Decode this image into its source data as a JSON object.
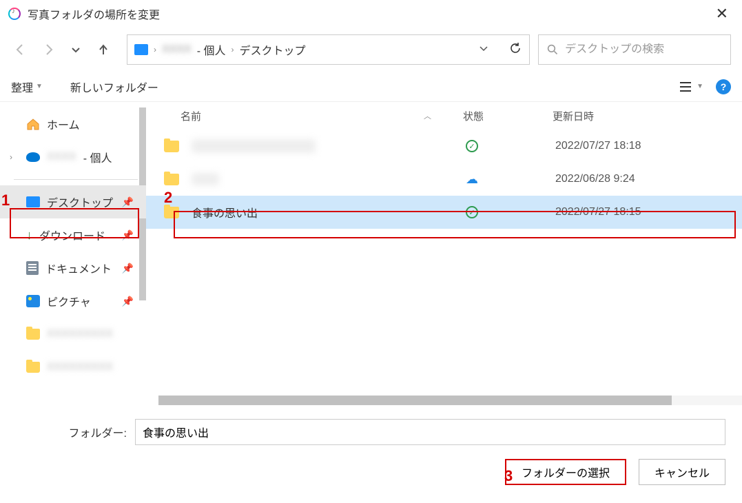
{
  "window": {
    "title": "写真フォルダの場所を変更"
  },
  "address": {
    "user_suffix": "- 個人",
    "crumb2": "デスクトップ"
  },
  "search": {
    "placeholder": "デスクトップの検索"
  },
  "toolbar": {
    "organize": "整理",
    "new_folder": "新しいフォルダー"
  },
  "sidebar": {
    "home": "ホーム",
    "personal_suffix": "- 個人",
    "desktop": "デスクトップ",
    "downloads": "ダウンロード",
    "documents": "ドキュメント",
    "pictures": "ピクチャ"
  },
  "columns": {
    "name": "名前",
    "status": "状態",
    "modified": "更新日時"
  },
  "files": [
    {
      "name_hidden": true,
      "status": "synced",
      "date": "2022/07/27 18:18"
    },
    {
      "name_hidden": true,
      "status": "cloud",
      "date": "2022/06/28 9:24"
    },
    {
      "name": "食事の思い出",
      "status": "synced",
      "date": "2022/07/27 18:15",
      "selected": true
    }
  ],
  "footer": {
    "folder_label": "フォルダー:",
    "folder_value": "食事の思い出",
    "select_button": "フォルダーの選択",
    "cancel_button": "キャンセル"
  },
  "annotations": {
    "n1": "1",
    "n2": "2",
    "n3": "3"
  }
}
